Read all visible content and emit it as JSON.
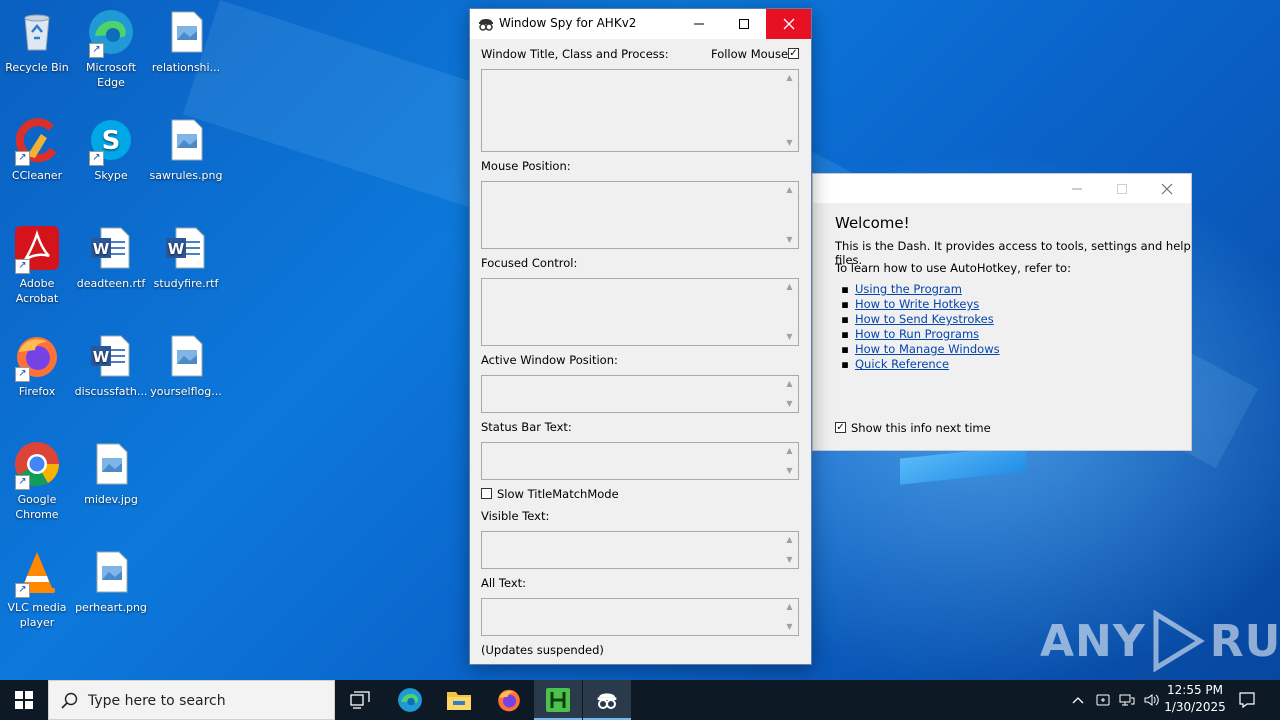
{
  "desktop": {
    "icons": [
      {
        "label": "Recycle Bin",
        "icon": "recycle-bin-icon"
      },
      {
        "label": "Microsoft Edge",
        "icon": "edge-icon"
      },
      {
        "label": "relationshi...",
        "icon": "image-file-icon"
      },
      {
        "label": "CCleaner",
        "icon": "ccleaner-icon"
      },
      {
        "label": "Skype",
        "icon": "skype-icon"
      },
      {
        "label": "sawrules.png",
        "icon": "image-file-icon"
      },
      {
        "label": "Adobe Acrobat",
        "icon": "acrobat-icon"
      },
      {
        "label": "deadteen.rtf",
        "icon": "word-doc-icon"
      },
      {
        "label": "studyfire.rtf",
        "icon": "word-doc-icon"
      },
      {
        "label": "Firefox",
        "icon": "firefox-icon"
      },
      {
        "label": "discussfath...",
        "icon": "word-doc-icon"
      },
      {
        "label": "yourselflog...",
        "icon": "image-file-icon"
      },
      {
        "label": "Google Chrome",
        "icon": "chrome-icon"
      },
      {
        "label": "midev.jpg",
        "icon": "image-file-icon"
      },
      {
        "label": "VLC media player",
        "icon": "vlc-icon"
      },
      {
        "label": "perheart.png",
        "icon": "image-file-icon"
      }
    ]
  },
  "spy": {
    "title": "Window Spy for AHKv2",
    "label_title": "Window Title, Class and Process:",
    "follow_mouse": "Follow Mouse",
    "follow_mouse_checked": true,
    "label_mouse": "Mouse Position:",
    "label_focused": "Focused Control:",
    "label_active_pos": "Active Window Position:",
    "label_status": "Status Bar Text:",
    "slow_mode": "Slow TitleMatchMode",
    "slow_mode_checked": false,
    "label_visible": "Visible Text:",
    "label_all": "All Text:",
    "footer": "(Updates suspended)"
  },
  "dash": {
    "heading": "Welcome!",
    "intro": "This is the Dash. It provides access to tools, settings and help files.",
    "learn": "To learn how to use AutoHotkey, refer to:",
    "links": [
      "Using the Program",
      "How to Write Hotkeys",
      "How to Send Keystrokes",
      "How to Run Programs",
      "How to Manage Windows",
      "Quick Reference"
    ],
    "show_info": "Show this info next time",
    "show_info_checked": true
  },
  "watermark": {
    "left": "ANY",
    "right": "RUN"
  },
  "taskbar": {
    "search_placeholder": "Type here to search",
    "time": "12:55 PM",
    "date": "1/30/2025",
    "colors": {
      "bar": "#0d1a26",
      "active_indicator": "#76b9ed"
    }
  }
}
